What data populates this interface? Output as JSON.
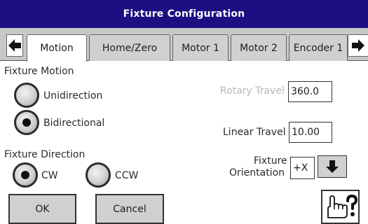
{
  "window": {
    "title": "Fixture Configuration"
  },
  "tabs": [
    {
      "label": "Motion",
      "active": true
    },
    {
      "label": "Home/Zero",
      "active": false
    },
    {
      "label": "Motor 1",
      "active": false
    },
    {
      "label": "Motor 2",
      "active": false
    },
    {
      "label": "Encoder 1",
      "active": false
    }
  ],
  "fixture_motion": {
    "heading": "Fixture Motion",
    "options": [
      {
        "label": "Unidirection",
        "selected": false
      },
      {
        "label": "Bidirectional",
        "selected": true
      }
    ]
  },
  "fixture_direction": {
    "heading": "Fixture Direction",
    "options": [
      {
        "label": "CW",
        "selected": true
      },
      {
        "label": "CCW",
        "selected": false
      }
    ]
  },
  "rotary_travel": {
    "label": "Rotary Travel",
    "value": "360.0",
    "disabled": true
  },
  "linear_travel": {
    "label": "Linear Travel",
    "value": "10.00"
  },
  "fixture_orientation": {
    "label_line1": "Fixture",
    "label_line2": "Orientation",
    "value": "+X"
  },
  "buttons": {
    "ok": "OK",
    "cancel": "Cancel",
    "help_icon": "hand-pointer-question-icon"
  },
  "colors": {
    "titlebar": "#1b0f82",
    "tab_strip": "#c8c8c8",
    "button_face": "#d0d0d0",
    "disabled_text": "#b8b8b8"
  }
}
